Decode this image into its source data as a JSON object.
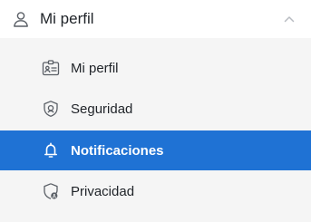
{
  "header": {
    "label": "Mi perfil",
    "icon": "user-icon",
    "chevron_icon": "chevron-up-icon",
    "expanded": true
  },
  "items": [
    {
      "label": "Mi perfil",
      "icon": "id-card-icon",
      "active": false
    },
    {
      "label": "Seguridad",
      "icon": "shield-icon",
      "active": false
    },
    {
      "label": "Notificaciones",
      "icon": "bell-icon",
      "active": true
    },
    {
      "label": "Privacidad",
      "icon": "shield-user-icon",
      "active": false
    }
  ],
  "colors": {
    "active_bg": "#1f72d4",
    "active_text": "#ffffff",
    "panel_bg": "#f5f5f5",
    "header_bg": "#ffffff"
  }
}
